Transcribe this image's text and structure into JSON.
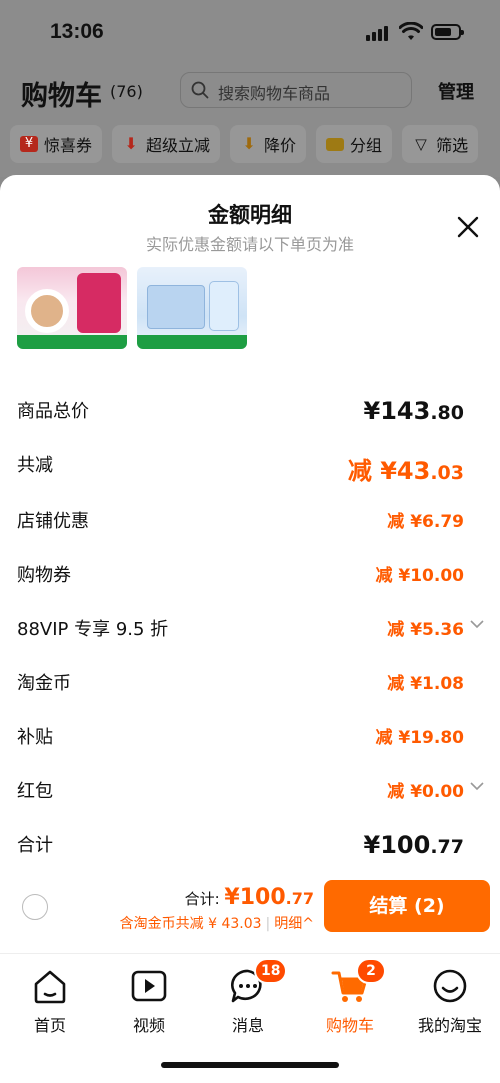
{
  "status_bar": {
    "time": "13:06"
  },
  "header": {
    "title": "购物车",
    "count": "(76)",
    "search_placeholder": "搜索购物车商品",
    "manage": "管理"
  },
  "filters": [
    {
      "label": "惊喜券",
      "icon": "coupon-icon"
    },
    {
      "label": "超级立减",
      "icon": "down-arrow-icon"
    },
    {
      "label": "降价",
      "icon": "price-drop-icon"
    },
    {
      "label": "分组",
      "icon": "folder-icon"
    },
    {
      "label": "筛选",
      "icon": "filter-icon"
    }
  ],
  "sheet": {
    "title": "金额明细",
    "subtitle": "实际优惠金额请以下单页为准",
    "rows": [
      {
        "label": "商品总价",
        "prefix": "",
        "int": "¥143",
        "dec": ".80",
        "style": "total"
      },
      {
        "label": "共减",
        "prefix": "减 ",
        "int": "¥43",
        "dec": ".03",
        "style": "orange-big"
      },
      {
        "label": "店铺优惠",
        "prefix": "减 ",
        "int": "¥6",
        "dec": ".79",
        "style": "orange"
      },
      {
        "label": "购物券",
        "prefix": "减 ",
        "int": "¥10",
        "dec": ".00",
        "style": "orange"
      },
      {
        "label": "88VIP 专享 9.5 折",
        "prefix": "减 ",
        "int": "¥5",
        "dec": ".36",
        "style": "orange",
        "chevron": true
      },
      {
        "label": "淘金币",
        "prefix": "减 ",
        "int": "¥1",
        "dec": ".08",
        "style": "orange"
      },
      {
        "label": "补贴",
        "prefix": "减 ",
        "int": "¥19",
        "dec": ".80",
        "style": "orange"
      },
      {
        "label": "红包",
        "prefix": "减 ",
        "int": "¥0",
        "dec": ".00",
        "style": "orange",
        "chevron": true
      },
      {
        "label": "合计",
        "prefix": "",
        "int": "¥100",
        "dec": ".77",
        "style": "total"
      }
    ]
  },
  "checkout": {
    "total_label": "合计:",
    "total_int": "¥100",
    "total_dec": ".77",
    "savings_text": "含淘金币共减 ¥ 43.03",
    "detail_link": "明细^",
    "button": "结算 (2)"
  },
  "tabs": [
    {
      "label": "首页",
      "icon": "home-icon"
    },
    {
      "label": "视频",
      "icon": "video-icon"
    },
    {
      "label": "消息",
      "icon": "message-icon",
      "badge": "18"
    },
    {
      "label": "购物车",
      "icon": "cart-icon",
      "badge": "2",
      "active": true
    },
    {
      "label": "我的淘宝",
      "icon": "profile-icon"
    }
  ],
  "colors": {
    "accent": "#ff6a00",
    "discount": "#ff5a00",
    "overlay": "#8c8c8c"
  }
}
